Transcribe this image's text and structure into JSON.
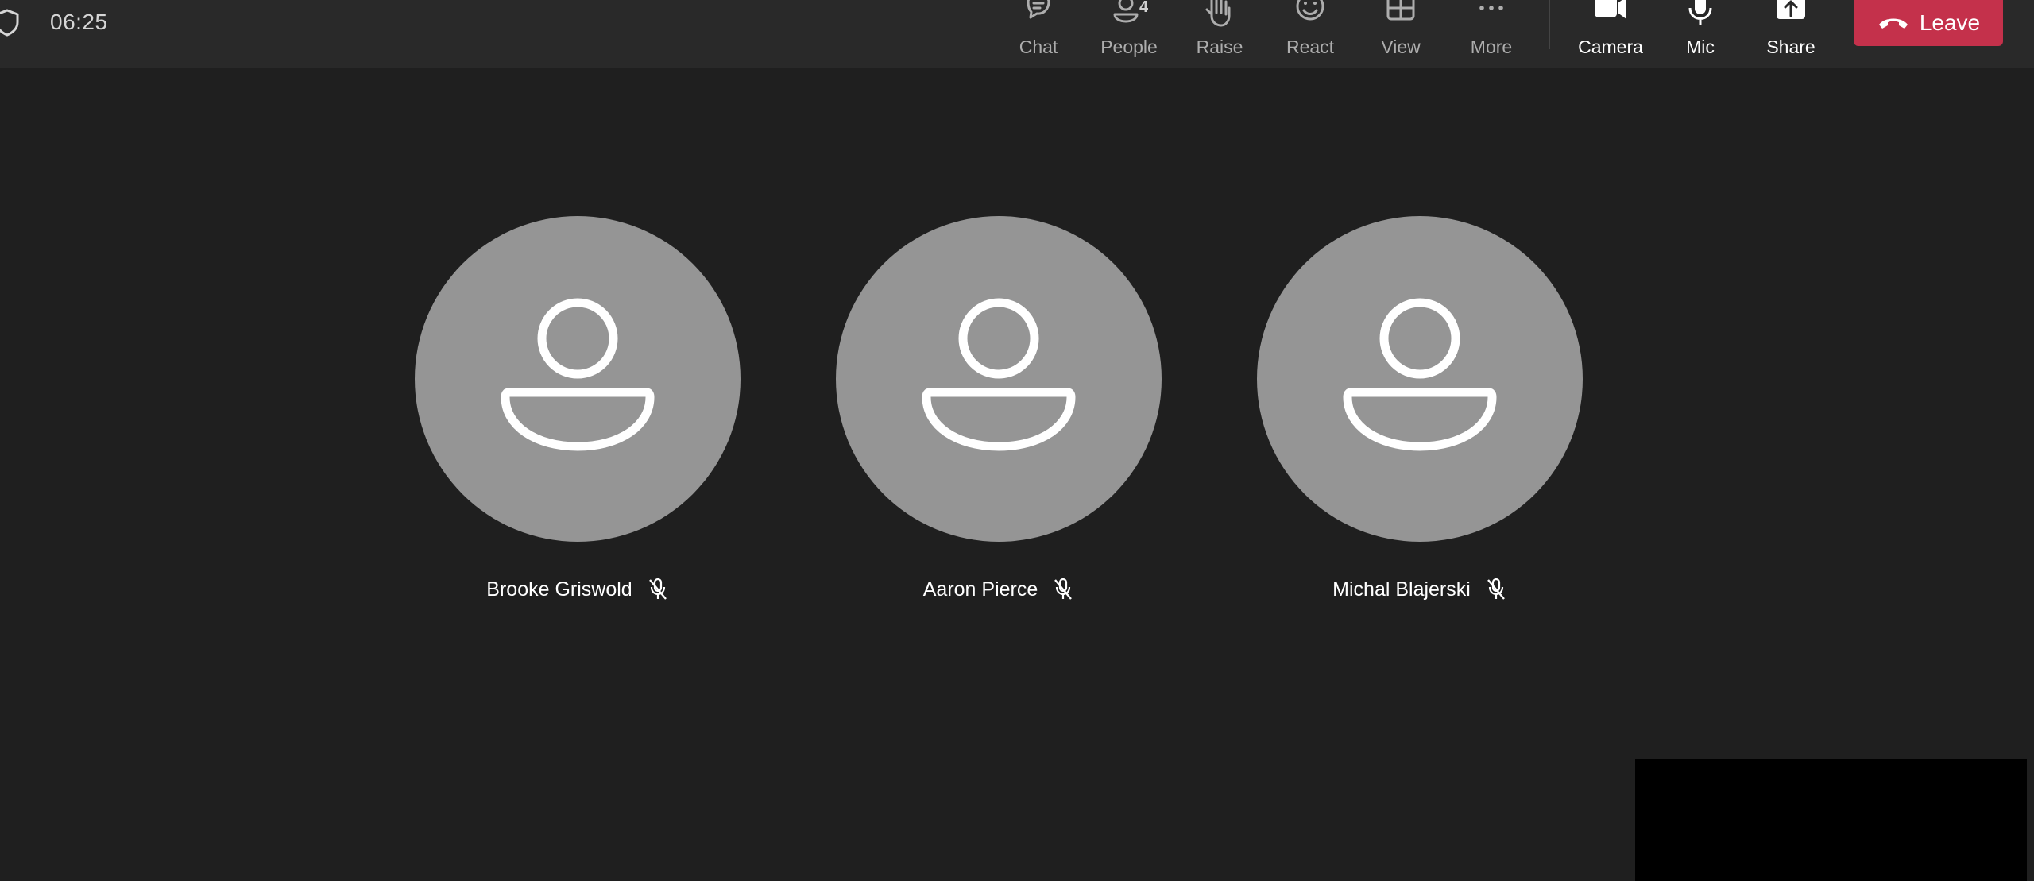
{
  "meeting": {
    "timer": "06:25"
  },
  "toolbar": {
    "chat_label": "Chat",
    "people_label": "People",
    "people_count": "4",
    "raise_label": "Raise",
    "react_label": "React",
    "view_label": "View",
    "more_label": "More",
    "camera_label": "Camera",
    "mic_label": "Mic",
    "share_label": "Share",
    "leave_label": "Leave"
  },
  "participants": [
    {
      "name": "Brooke Griswold",
      "muted": true
    },
    {
      "name": "Aaron Pierce",
      "muted": true
    },
    {
      "name": "Michal Blajerski",
      "muted": true
    }
  ],
  "colors": {
    "background": "#1f1f1f",
    "toolbar": "#292929",
    "leave": "#c4314b",
    "avatar": "#959595"
  }
}
